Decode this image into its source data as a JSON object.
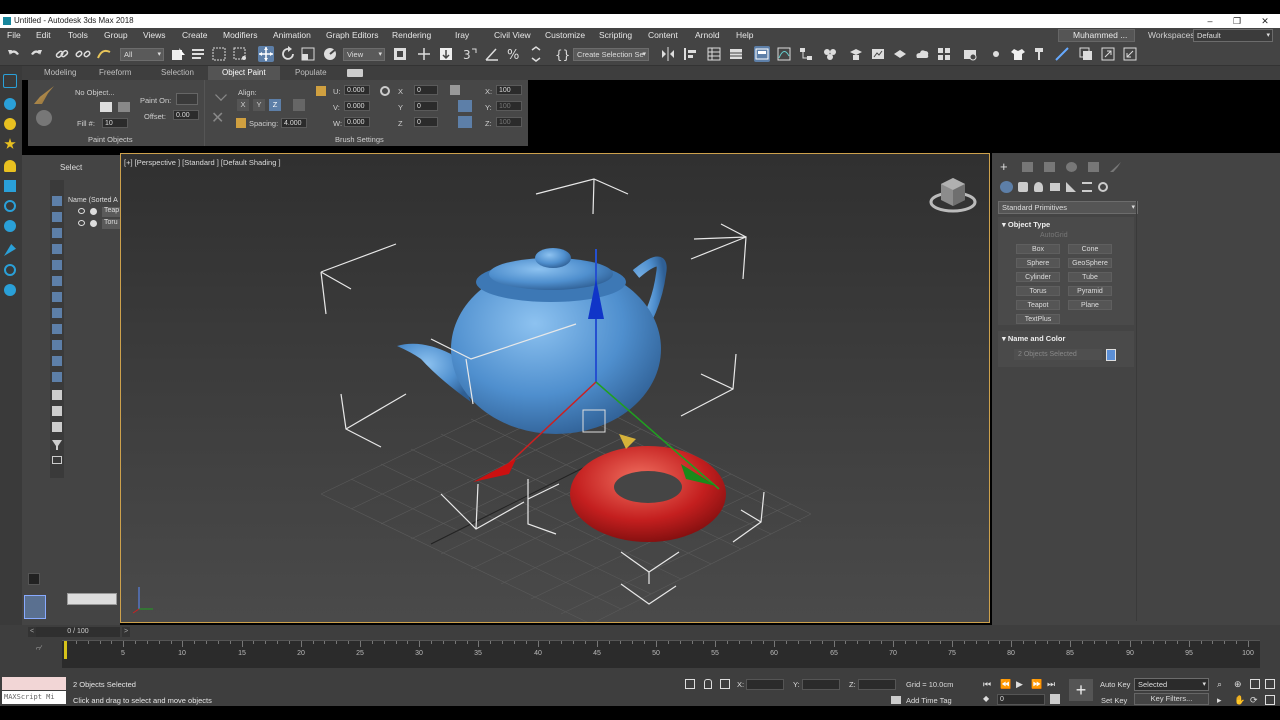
{
  "window": {
    "title": "Untitled - Autodesk 3ds Max 2018",
    "controls": [
      "–",
      "❐",
      "✕"
    ]
  },
  "menu": {
    "items": [
      "File",
      "Edit",
      "Tools",
      "Group",
      "Views",
      "Create",
      "Modifiers",
      "Animation",
      "Graph Editors",
      "Rendering",
      "Iray",
      "Civil View",
      "Customize",
      "Scripting",
      "Content",
      "Arnold",
      "Help"
    ],
    "user": "Muhammed ...",
    "workspaces_label": "Workspaces:",
    "workspaces_value": "Default"
  },
  "toolbar": {
    "filter_value": "All",
    "view_value": "View",
    "selection_set_value": "Create Selection Se"
  },
  "ribbon": {
    "tabs": [
      "Modeling",
      "Freeform",
      "Selection",
      "Object Paint",
      "Populate"
    ],
    "no_object": "No Object...",
    "paint_on": "Paint On:",
    "fill_label": "Fill #:",
    "fill_value": "10",
    "offset_label": "Offset:",
    "offset_value": "0.00",
    "paint_objects": "Paint Objects",
    "align_label": "Align:",
    "axes": [
      "X",
      "Y",
      "Z"
    ],
    "spacing_label": "Spacing:",
    "spacing_value": "4.000",
    "u_label": "U:",
    "u_value": "0.000",
    "v_label": "V:",
    "v_value": "0.000",
    "w_label": "W:",
    "w_value": "0.000",
    "sx_label": "X",
    "sx_value": "0",
    "sy_label": "Y",
    "sy_value": "0",
    "sz_label": "Z",
    "sz_value": "0",
    "x_label": "X:",
    "x_value": "100",
    "y_label": "Y:",
    "y_value": "100",
    "z_label": "Z:",
    "z_value": "100",
    "brush_settings": "Brush Settings"
  },
  "scene_explorer": {
    "tab": "Select",
    "header": "Name (Sorted A",
    "rows": [
      "Teap",
      "Toru"
    ]
  },
  "viewport": {
    "label": "[+] [Perspective ] [Standard ] [Default Shading ]"
  },
  "command_panel": {
    "dropdown": "Standard Primitives",
    "object_type": "Object Type",
    "autogrid": "AutoGrid",
    "buttons": [
      "Box",
      "Cone",
      "Sphere",
      "GeoSphere",
      "Cylinder",
      "Tube",
      "Torus",
      "Pyramid",
      "Teapot",
      "Plane",
      "TextPlus"
    ],
    "name_and_color": "Name and Color",
    "selected_name": "2 Objects Selected",
    "object_color": "#5b8fd6"
  },
  "timeline": {
    "frame_display": "0 / 100",
    "ticks": [
      "5",
      "10",
      "15",
      "20",
      "25",
      "30",
      "35",
      "40",
      "45",
      "50",
      "55",
      "60",
      "65",
      "70",
      "75",
      "80",
      "85",
      "90",
      "95",
      "100"
    ]
  },
  "status": {
    "maxscript": "MAXScript Mi",
    "selection": "2 Objects Selected",
    "prompt": "Click and drag to select and move objects",
    "x_label": "X:",
    "y_label": "Y:",
    "z_label": "Z:",
    "grid": "Grid = 10.0cm",
    "add_time_tag": "Add Time Tag",
    "auto_key": "Auto Key",
    "set_key": "Set Key",
    "selected_dd": "Selected",
    "key_filters": "Key Filters...",
    "frame": "0"
  },
  "colors": {
    "teapot": "#4f8fce",
    "torus": "#c41f1f",
    "viewport_border": "#cda14c",
    "accent": "#5d7fa8"
  }
}
